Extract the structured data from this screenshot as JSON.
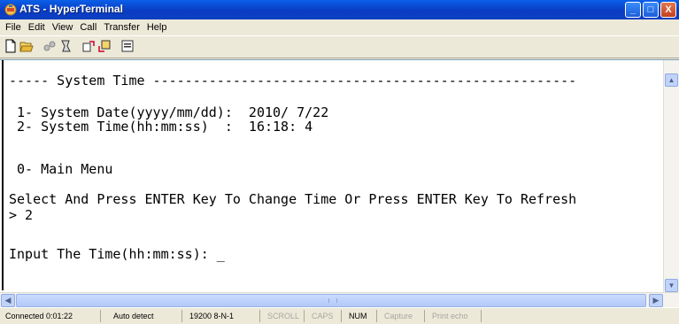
{
  "window": {
    "title": "ATS - HyperTerminal",
    "controls": [
      "_",
      "□",
      "X"
    ]
  },
  "menu": [
    "File",
    "Edit",
    "View",
    "Call",
    "Transfer",
    "Help"
  ],
  "toolbar": {
    "icons": [
      "new-icon",
      "open-icon",
      "disconnect-icon",
      "dial-icon",
      "send-icon",
      "receive-icon",
      "properties-icon"
    ]
  },
  "terminal": {
    "lines": [
      "----- System Time -----------------------------------------------------",
      "",
      " 1- System Date(yyyy/mm/dd):  2010/ 7/22",
      " 2- System Time(hh:mm:ss)  :  16:18: 4",
      "",
      " 0- Main Menu",
      "",
      "Select And Press ENTER Key To Change Time Or Press ENTER Key To Refresh",
      "> 2",
      "",
      "Input The Time(hh:mm:ss): _"
    ]
  },
  "status": {
    "connected": "Connected 0:01:22",
    "detect": "Auto detect",
    "settings": "19200 8-N-1",
    "scroll": "SCROLL",
    "caps": "CAPS",
    "num": "NUM",
    "capture": "Capture",
    "print_echo": "Print echo"
  },
  "colors": {
    "titlebar": "#0a5fe8",
    "window_bg": "#ece9d8",
    "terminal_bg": "#ffffff"
  }
}
